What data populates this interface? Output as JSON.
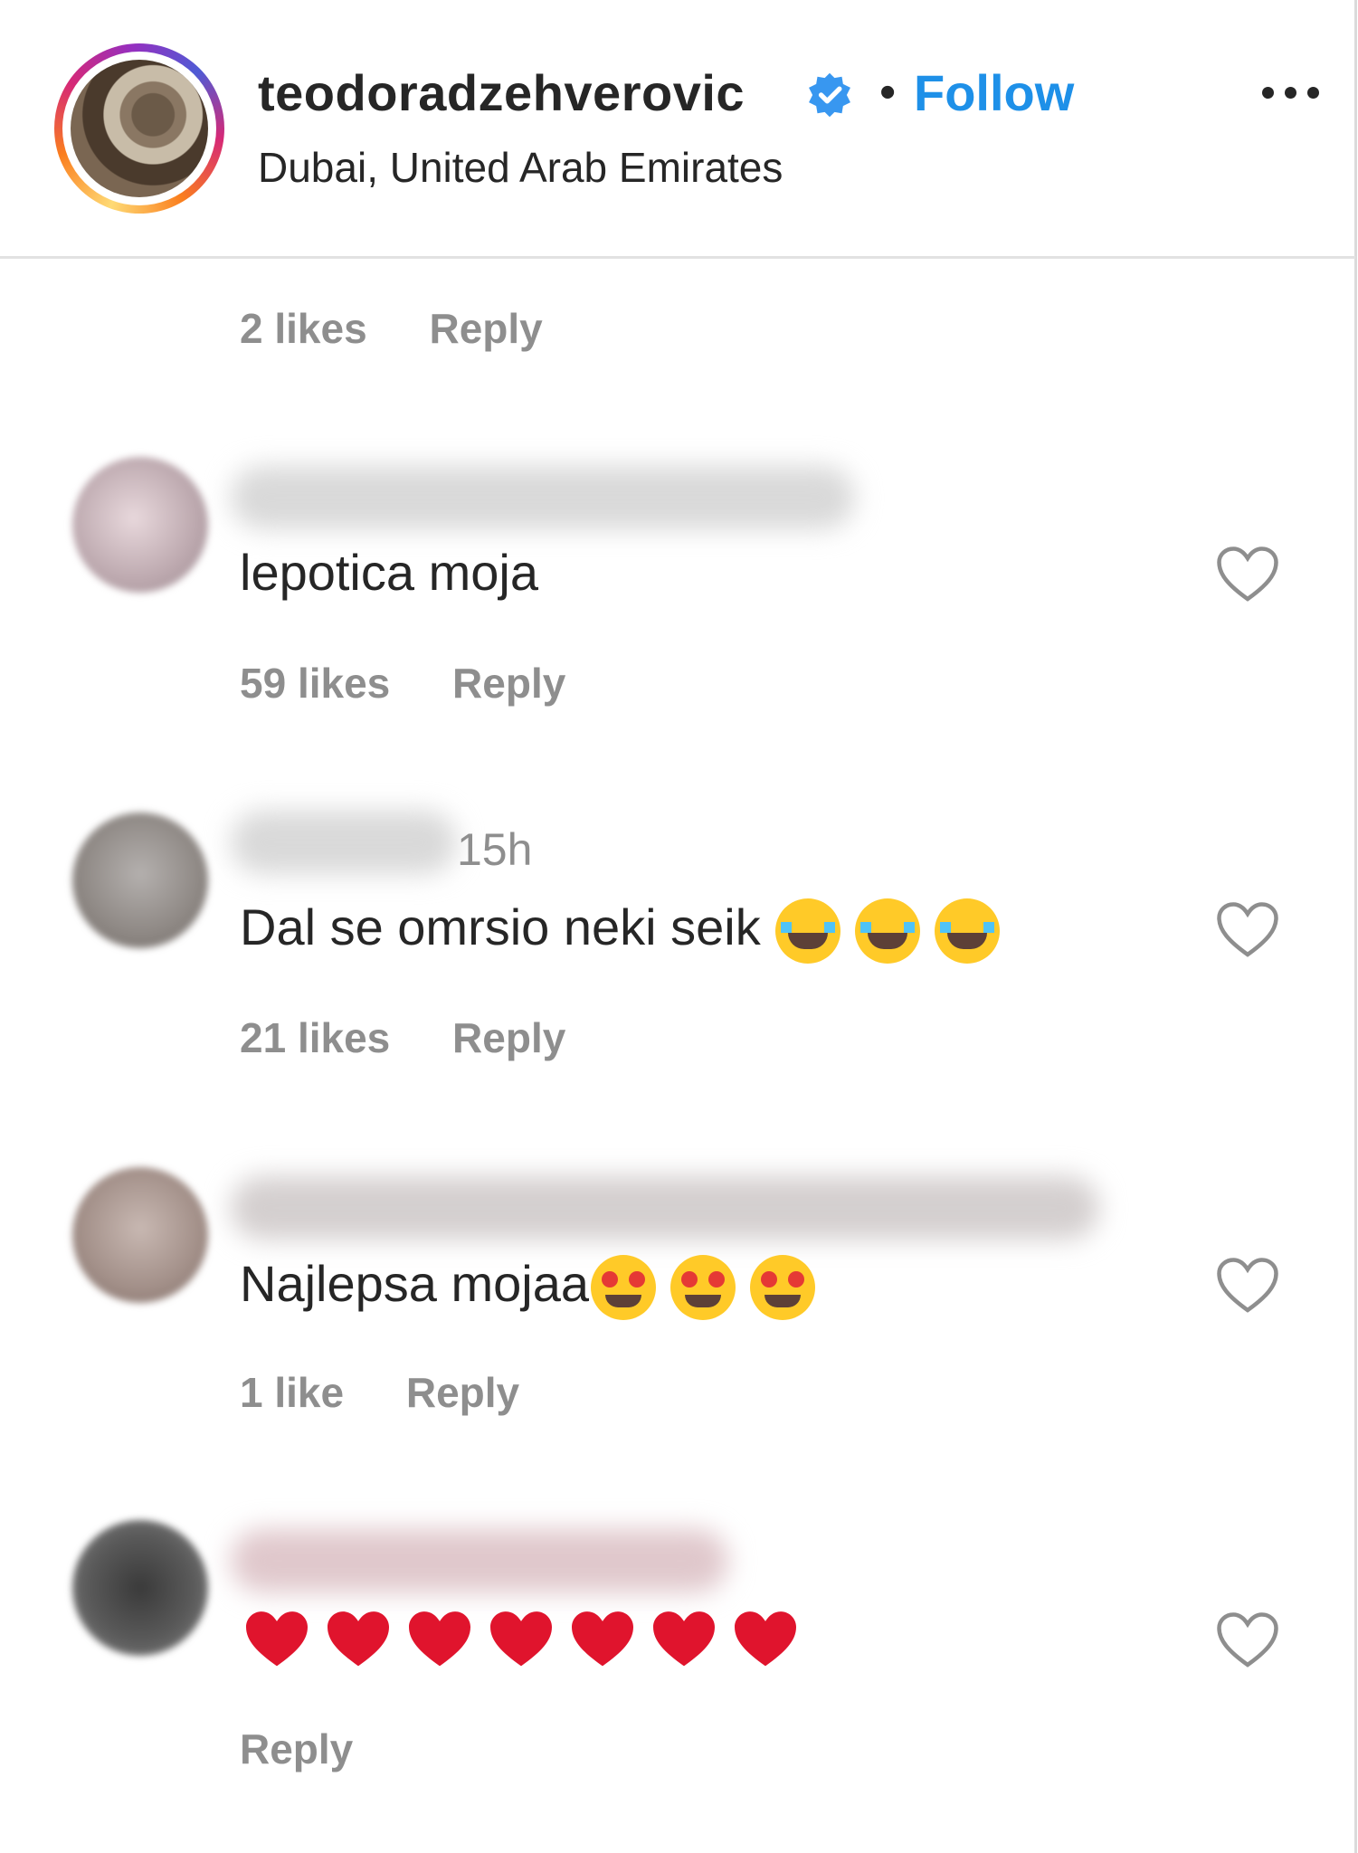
{
  "header": {
    "username": "teodoradzehverovic",
    "separator": "•",
    "follow_label": "Follow",
    "location": "Dubai, United Arab Emirates"
  },
  "first_meta": {
    "likes": "2 likes",
    "reply": "Reply"
  },
  "comments": [
    {
      "text": "lepotica moja",
      "likes": "59 likes",
      "reply": "Reply",
      "time": ""
    },
    {
      "text": "Dal se omrsio neki seik",
      "likes": "21 likes",
      "reply": "Reply",
      "time": "15h",
      "emoji": "face-with-tears-of-joy x3"
    },
    {
      "text": "Najlepsa mojaa",
      "likes": "1 like",
      "reply": "Reply",
      "time": "",
      "emoji": "star-struck x3"
    },
    {
      "text": "",
      "likes": "",
      "reply": "Reply",
      "time": "",
      "emoji": "red-heart x7"
    }
  ],
  "colors": {
    "follow": "#1e90e8",
    "text": "#262626",
    "muted": "#8e8e8e"
  }
}
